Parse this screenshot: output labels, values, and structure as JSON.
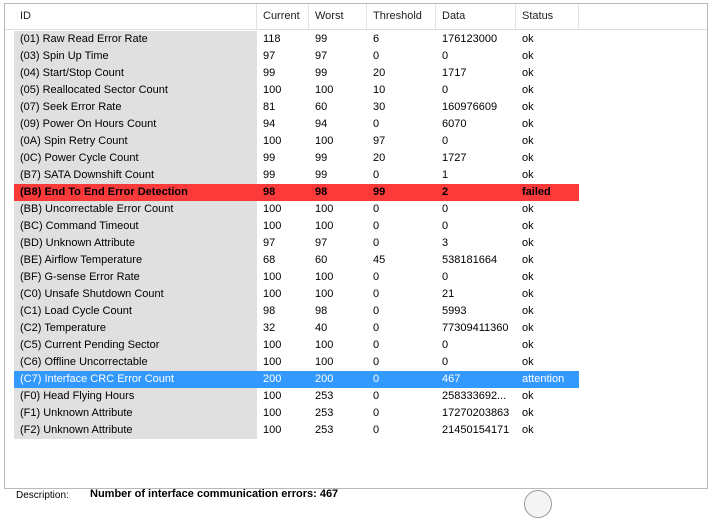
{
  "columns": [
    "ID",
    "Current",
    "Worst",
    "Threshold",
    "Data",
    "Status"
  ],
  "rows": [
    {
      "id": "(01) Raw Read Error Rate",
      "current": "118",
      "worst": "99",
      "threshold": "6",
      "data": "176123000",
      "status": "ok"
    },
    {
      "id": "(03) Spin Up Time",
      "current": "97",
      "worst": "97",
      "threshold": "0",
      "data": "0",
      "status": "ok"
    },
    {
      "id": "(04) Start/Stop Count",
      "current": "99",
      "worst": "99",
      "threshold": "20",
      "data": "1717",
      "status": "ok"
    },
    {
      "id": "(05) Reallocated Sector Count",
      "current": "100",
      "worst": "100",
      "threshold": "10",
      "data": "0",
      "status": "ok"
    },
    {
      "id": "(07) Seek Error Rate",
      "current": "81",
      "worst": "60",
      "threshold": "30",
      "data": "160976609",
      "status": "ok"
    },
    {
      "id": "(09) Power On Hours Count",
      "current": "94",
      "worst": "94",
      "threshold": "0",
      "data": "6070",
      "status": "ok"
    },
    {
      "id": "(0A) Spin Retry Count",
      "current": "100",
      "worst": "100",
      "threshold": "97",
      "data": "0",
      "status": "ok"
    },
    {
      "id": "(0C) Power Cycle Count",
      "current": "99",
      "worst": "99",
      "threshold": "20",
      "data": "1727",
      "status": "ok"
    },
    {
      "id": "(B7) SATA Downshift Count",
      "current": "99",
      "worst": "99",
      "threshold": "0",
      "data": "1",
      "status": "ok"
    },
    {
      "id": "(B8) End To End Error Detection",
      "current": "98",
      "worst": "98",
      "threshold": "99",
      "data": "2",
      "status": "failed"
    },
    {
      "id": "(BB) Uncorrectable Error Count",
      "current": "100",
      "worst": "100",
      "threshold": "0",
      "data": "0",
      "status": "ok"
    },
    {
      "id": "(BC) Command Timeout",
      "current": "100",
      "worst": "100",
      "threshold": "0",
      "data": "0",
      "status": "ok"
    },
    {
      "id": "(BD) Unknown Attribute",
      "current": "97",
      "worst": "97",
      "threshold": "0",
      "data": "3",
      "status": "ok"
    },
    {
      "id": "(BE) Airflow Temperature",
      "current": "68",
      "worst": "60",
      "threshold": "45",
      "data": "538181664",
      "status": "ok"
    },
    {
      "id": "(BF) G-sense Error Rate",
      "current": "100",
      "worst": "100",
      "threshold": "0",
      "data": "0",
      "status": "ok"
    },
    {
      "id": "(C0) Unsafe Shutdown Count",
      "current": "100",
      "worst": "100",
      "threshold": "0",
      "data": "21",
      "status": "ok"
    },
    {
      "id": "(C1) Load Cycle Count",
      "current": "98",
      "worst": "98",
      "threshold": "0",
      "data": "5993",
      "status": "ok"
    },
    {
      "id": "(C2) Temperature",
      "current": "32",
      "worst": "40",
      "threshold": "0",
      "data": "77309411360",
      "status": "ok"
    },
    {
      "id": "(C5) Current Pending Sector",
      "current": "100",
      "worst": "100",
      "threshold": "0",
      "data": "0",
      "status": "ok"
    },
    {
      "id": "(C6) Offline Uncorrectable",
      "current": "100",
      "worst": "100",
      "threshold": "0",
      "data": "0",
      "status": "ok"
    },
    {
      "id": "(C7) Interface CRC Error Count",
      "current": "200",
      "worst": "200",
      "threshold": "0",
      "data": "467",
      "status": "attention"
    },
    {
      "id": "(F0) Head Flying Hours",
      "current": "100",
      "worst": "253",
      "threshold": "0",
      "data": "258333692...",
      "status": "ok"
    },
    {
      "id": "(F1) Unknown Attribute",
      "current": "100",
      "worst": "253",
      "threshold": "0",
      "data": "17270203863",
      "status": "ok"
    },
    {
      "id": "(F2) Unknown Attribute",
      "current": "100",
      "worst": "253",
      "threshold": "0",
      "data": "21450154171",
      "status": "ok"
    }
  ],
  "description": {
    "label": "Description:",
    "value": "Number of interface communication errors: 467"
  },
  "colors": {
    "failed_row": "#fd3a3a",
    "selected_row": "#3399ff",
    "id_column_bg": "#e0e0e0"
  }
}
